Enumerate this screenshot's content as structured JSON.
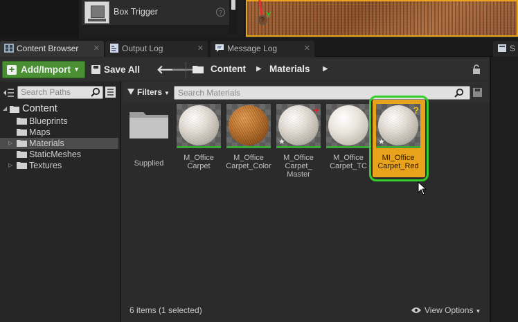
{
  "top": {
    "item_label": "Box Trigger",
    "help_glyph": "?",
    "gizmo_axis_label": "Y",
    "gizmo_z_glyph": "?"
  },
  "tabs": [
    {
      "label": "Content Browser",
      "icon": "content-browser-icon",
      "active": true
    },
    {
      "label": "Output Log",
      "icon": "output-log-icon",
      "active": false
    },
    {
      "label": "Message Log",
      "icon": "message-log-icon",
      "active": false
    },
    {
      "label": "S",
      "icon": "tab-icon",
      "active": false
    }
  ],
  "toolbar": {
    "add_import": "Add/Import",
    "save_all": "Save All",
    "breadcrumb": [
      "Content",
      "Materials"
    ]
  },
  "sources": {
    "search_placeholder": "Search Paths",
    "tree": [
      {
        "label": "Content",
        "expanded": true
      },
      {
        "label": "Blueprints"
      },
      {
        "label": "Maps"
      },
      {
        "label": "Materials",
        "selected": true
      },
      {
        "label": "StaticMeshes"
      },
      {
        "label": "Textures"
      }
    ]
  },
  "assets": {
    "filters_label": "Filters",
    "search_placeholder": "Search Materials",
    "items": [
      {
        "name": "Supplied",
        "type": "folder"
      },
      {
        "name": "M_Office\nCarpet",
        "type": "material"
      },
      {
        "name": "M_Office\nCarpet_Color",
        "type": "material"
      },
      {
        "name": "M_Office\nCarpet_\nMaster",
        "type": "material",
        "badge": "+"
      },
      {
        "name": "M_Office\nCarpet_TC",
        "type": "material"
      },
      {
        "name": "MI_Office\nCarpet_Red",
        "type": "material-instance",
        "badge": "?",
        "selected": true
      }
    ]
  },
  "status": {
    "summary": "6 items (1 selected)",
    "view_options": "View Options"
  },
  "colors": {
    "accent_selected": "#e8a21c",
    "highlight_ring": "#35d12a",
    "add_button": "#4a8f34",
    "material_bar": "#3fa63a"
  }
}
